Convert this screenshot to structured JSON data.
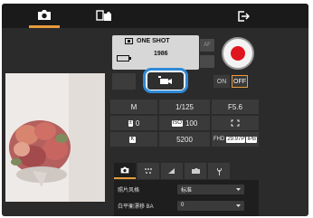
{
  "tabs": [
    {
      "name": "camera",
      "icon": "camera-icon"
    },
    {
      "name": "browse",
      "icon": "browse-images-icon"
    }
  ],
  "status": {
    "focus_mode": "ONE SHOT",
    "shots": "1986"
  },
  "af_label": "AF",
  "onoff": {
    "on": "ON",
    "off": "OFF"
  },
  "settings_grid": {
    "row1": [
      "M",
      "1/125",
      "F5.6"
    ],
    "row2": {
      "exposure_comp": "0",
      "iso_label": "ISO",
      "iso": "100"
    },
    "row3": {
      "wb_label": "K",
      "wb": "5200",
      "quality": "FHD"
    }
  },
  "bottom_settings": [
    {
      "label": "照片风格",
      "value": "标准"
    },
    {
      "label": "白平衡漂移 BA",
      "value": "0"
    }
  ],
  "colors": {
    "accent": "#e89b3c",
    "record": "#e0141e",
    "highlight": "#2e8ad6"
  }
}
